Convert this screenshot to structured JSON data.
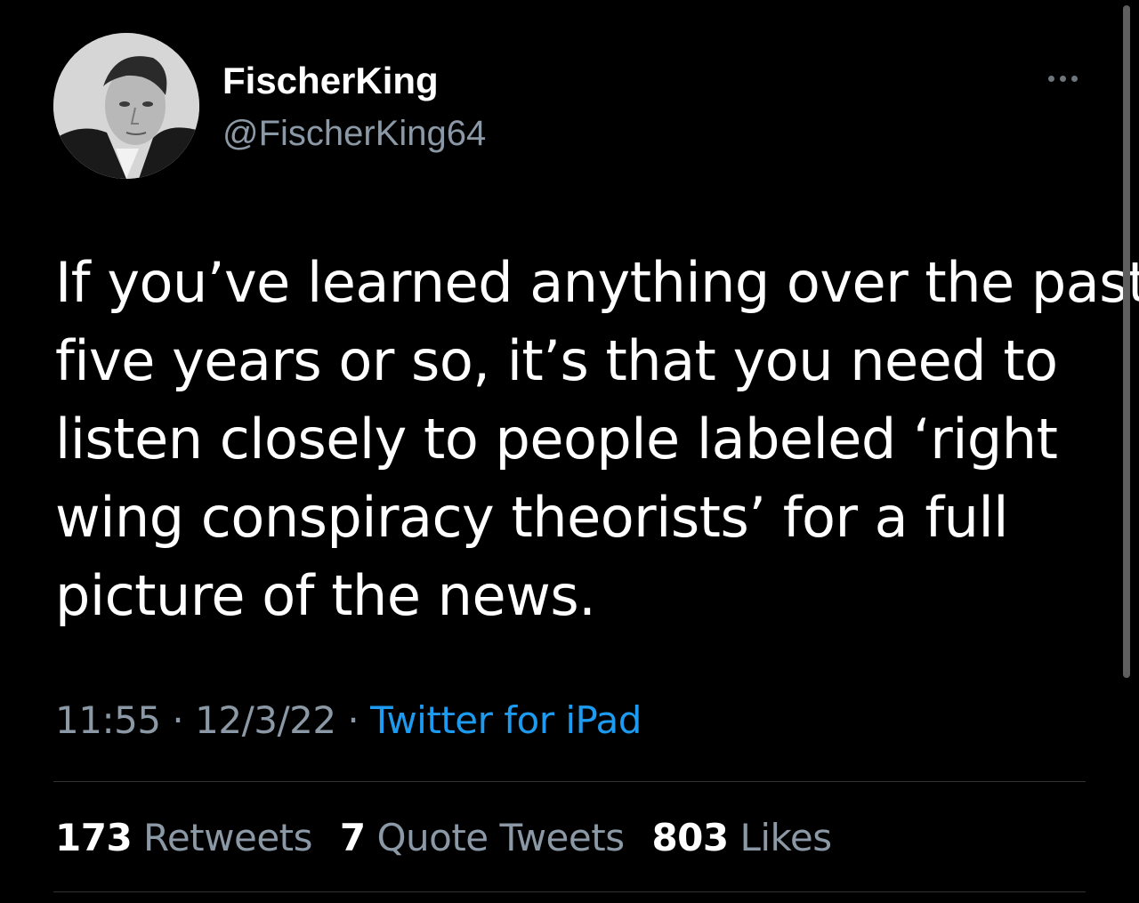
{
  "author": {
    "display_name": "FischerKing",
    "handle": "@FischerKing64"
  },
  "tweet": {
    "lines": [
      "If you’ve learned anything over the past",
      "five years or so, it’s that you need to",
      "listen closely to people labeled ‘right",
      "wing conspiracy theorists’ for a full",
      "picture of the news."
    ]
  },
  "meta": {
    "time": "11:55",
    "date": "12/3/22",
    "separator": "·",
    "source": "Twitter for iPad"
  },
  "stats": {
    "retweets": {
      "count": "173",
      "label": "Retweets"
    },
    "quote_tweets": {
      "count": "7",
      "label": "Quote Tweets"
    },
    "likes": {
      "count": "803",
      "label": "Likes"
    }
  },
  "icons": {
    "more": "more-horizontal-icon"
  },
  "colors": {
    "background": "#000000",
    "text_primary": "#ffffff",
    "text_muted": "#8b98a5",
    "link": "#1d9bf0",
    "divider": "#2f3336"
  }
}
